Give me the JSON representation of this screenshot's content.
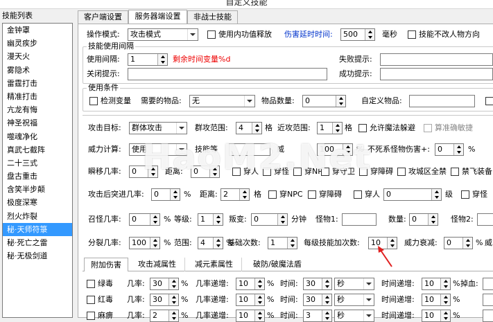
{
  "window": {
    "title": "自定义技能"
  },
  "left": {
    "header": "技能列表",
    "items": [
      "金钟罩",
      "幽灵疾步",
      "漫天火",
      "雾隐术",
      "雷霆打击",
      "精准打击",
      "亢龙有悔",
      "神圣祝福",
      "噬魂净化",
      "真武七截阵",
      "二十三式",
      "盘古重击",
      "含笑半步颠",
      "极度深寒",
      "烈火炸裂",
      "秘·天师符箓",
      "秘·死亡之雷",
      "秘·无极剑道"
    ],
    "selected_index": 15
  },
  "tabs": [
    "客户端设置",
    "服务器端设置",
    "非战士技能"
  ],
  "active_tab": 1,
  "row1": {
    "mode_label": "操作模式:",
    "mode_value": "攻击模式",
    "internal_label": "使用内功值释放",
    "delay_label": "伤害延时时间:",
    "delay_value": "500",
    "delay_unit": "毫秒",
    "noturn_label": "技能不改人物方向"
  },
  "interval": {
    "title": "技能使用间隔",
    "use_label": "使用间隔:",
    "use_value": "1",
    "remain_hint": "剩余时间变量%d",
    "close_label": "关闭提示:",
    "close_value": "",
    "fail_label": "失败提示:",
    "fail_value": "",
    "success_label": "成功提示:",
    "success_value": ""
  },
  "condition": {
    "title": "使用条件",
    "check_var_label": "检测变量",
    "need_item_label": "需要的物品:",
    "need_item_value": "无",
    "item_count_label": "物品数量:",
    "item_count_value": "0",
    "custom_item_label": "自定义物品:",
    "custom_item_value": ""
  },
  "attack": {
    "target_label": "攻击目标:",
    "target_value": "群体攻击",
    "range_label": "群攻范围:",
    "range_value": "4",
    "range_unit": "格",
    "near_label": "近攻范围:",
    "near_value": "1",
    "near_unit": "格",
    "allow_dodge_label": "允许魔法躲避",
    "accurate_label": "算准确敏捷"
  },
  "power": {
    "calc_label": "威力计算:",
    "calc_value": "使用",
    "level_label": "技能等",
    "level_value": "",
    "power_label": "威",
    "power_value": "100",
    "power_unit": "%",
    "immortal_label": "不死系怪物伤害+:",
    "immortal_value": "0",
    "immortal_unit": "%"
  },
  "teleport": {
    "chance_label": "瞬移几率:",
    "chance_value": "0",
    "dist_label": "距离:",
    "dist_value": "0",
    "through_label": "穿人",
    "through2_label": "穿怪",
    "npc_label": "穿NPC",
    "shield_label": "穿守卫",
    "obstacle_label": "穿障碍",
    "city_label": "攻城区全禁",
    "nofly_label": "禁飞装备"
  },
  "dash": {
    "chance_label": "攻击后突进几率:",
    "chance_value": "0",
    "chance_unit": "%",
    "dist_label": "距离:",
    "dist_value": "2",
    "dist_unit": "格",
    "npc_label": "穿NPC",
    "obstacle_label": "穿障碍",
    "person_label": "穿人",
    "level_value": "0",
    "level_unit": "级",
    "monster_label": "穿怪"
  },
  "summon": {
    "chance_label": "召怪几率:",
    "chance_value": "0",
    "chance_unit": "%",
    "level_label": "等级:",
    "level_value": "1",
    "revolt_label": "叛变:",
    "revolt_value": "0",
    "revolt_unit": "分钟",
    "monster1_label": "怪物1:",
    "monster1_value": "",
    "count_label": "数量:",
    "count_value": "0",
    "monster2_label": "怪物2:"
  },
  "split": {
    "chance_label": "分裂几率:",
    "chance_value": "100",
    "chance_unit": "%",
    "range_label": "范围:",
    "range_value": "4",
    "range_unit": "%",
    "base_label": "基础次数:",
    "base_value": "1",
    "per_level_label": "每级技能加次数:",
    "per_level_value": "10",
    "decay_label": "威力衰减:",
    "decay_value": "0",
    "decay_unit": "%",
    "decay_tail": "威"
  },
  "bottom_tabs": [
    "附加伤害",
    "攻击减属性",
    "减元素属性",
    "破防/破魔法盾"
  ],
  "bottom_active": 0,
  "effects": [
    {
      "name": "绿毒",
      "chance_label": "几率:",
      "chance": "30",
      "inc_label": "几率递增:",
      "inc": "10",
      "time_label": "时间:",
      "time": "30",
      "unit": "秒",
      "time_inc_label": "时间递增:",
      "time_inc": "10",
      "extra_label": "掉血:"
    },
    {
      "name": "红毒",
      "chance_label": "几率:",
      "chance": "30",
      "inc_label": "几率递增:",
      "inc": "10",
      "time_label": "时间:",
      "time": "30",
      "unit": "秒",
      "time_inc_label": "时间递增:",
      "time_inc": "10",
      "extra_label": ""
    },
    {
      "name": "麻痹",
      "chance_label": "几率:",
      "chance": "2",
      "inc_label": "几率递增:",
      "inc": "10",
      "time_label": "时间:",
      "time": "3",
      "unit": "秒",
      "time_inc_label": "时间递增:",
      "time_inc": "10",
      "extra_label": ""
    }
  ],
  "watermark": "HaoM2.Net",
  "percent": "%"
}
